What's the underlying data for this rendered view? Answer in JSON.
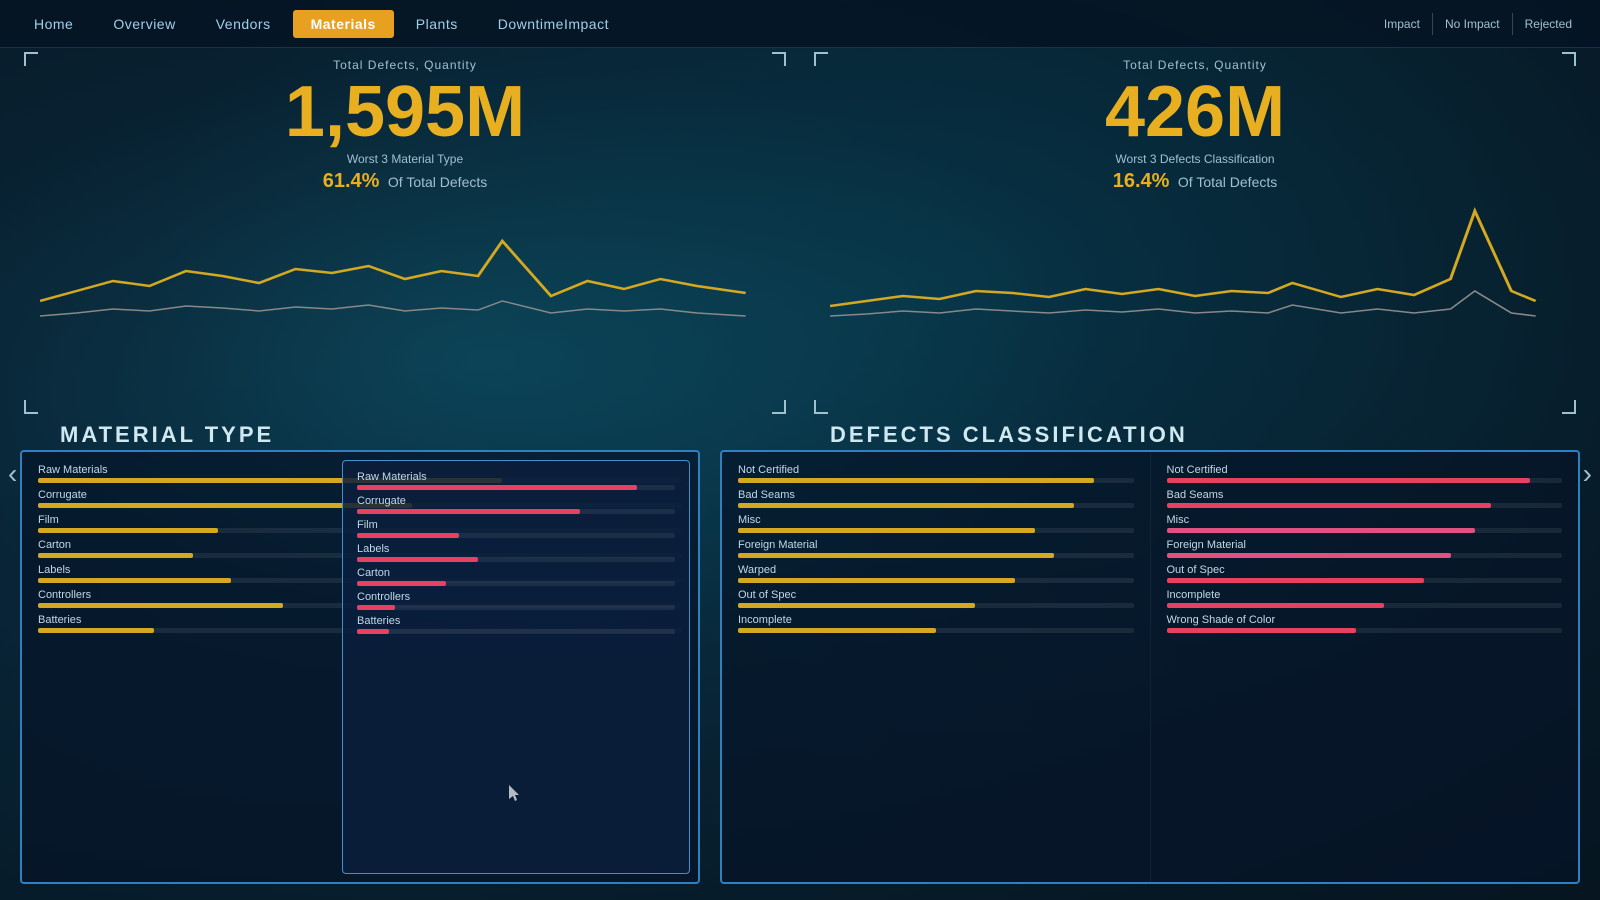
{
  "topbar": {
    "nav_items": [
      {
        "label": "Home",
        "active": false
      },
      {
        "label": "Overview",
        "active": false
      },
      {
        "label": "Vendors",
        "active": false
      },
      {
        "label": "Materials",
        "active": true
      },
      {
        "label": "Plants",
        "active": false
      },
      {
        "label": "DowntimeImpact",
        "active": false
      }
    ],
    "filters": [
      {
        "label": "Impact"
      },
      {
        "label": "No Impact"
      },
      {
        "label": "Rejected"
      }
    ]
  },
  "left_chart": {
    "title": "Total Defects, Quantity",
    "value": "1,595M",
    "subtitle": "Worst 3 Material Type",
    "pct": "61.4%",
    "pct_label": "Of Total Defects"
  },
  "right_chart": {
    "title": "Total Defects, Quantity",
    "value": "426M",
    "subtitle": "Worst 3 Defects Classification",
    "pct": "16.4%",
    "pct_label": "Of Total Defects"
  },
  "section_labels": {
    "left": "Material Type",
    "right": "Defects Classification"
  },
  "left_table_col1": {
    "rows": [
      {
        "label": "Raw Materials",
        "bar_pct": 72,
        "color": "yellow"
      },
      {
        "label": "Corrugate",
        "bar_pct": 58,
        "color": "yellow"
      },
      {
        "label": "Film",
        "bar_pct": 28,
        "color": "yellow"
      },
      {
        "label": "Carton",
        "bar_pct": 24,
        "color": "yellow"
      },
      {
        "label": "Labels",
        "bar_pct": 30,
        "color": "yellow"
      },
      {
        "label": "Controllers",
        "bar_pct": 38,
        "color": "yellow"
      },
      {
        "label": "Batteries",
        "bar_pct": 18,
        "color": "yellow"
      }
    ]
  },
  "left_table_highlight": {
    "rows": [
      {
        "label": "Raw Materials",
        "bar_pct": 88,
        "color": "red"
      },
      {
        "label": "Corrugate",
        "bar_pct": 70,
        "color": "red"
      },
      {
        "label": "Film",
        "bar_pct": 32,
        "color": "red"
      },
      {
        "label": "Labels",
        "bar_pct": 38,
        "color": "red"
      },
      {
        "label": "Carton",
        "bar_pct": 28,
        "color": "red"
      },
      {
        "label": "Controllers",
        "bar_pct": 12,
        "color": "red"
      },
      {
        "label": "Batteries",
        "bar_pct": 10,
        "color": "red"
      }
    ]
  },
  "right_table_col1": {
    "rows": [
      {
        "label": "Not Certified",
        "bar_pct": 90,
        "color": "yellow"
      },
      {
        "label": "Bad Seams",
        "bar_pct": 85,
        "color": "yellow"
      },
      {
        "label": "Misc",
        "bar_pct": 75,
        "color": "yellow"
      },
      {
        "label": "Foreign Material",
        "bar_pct": 80,
        "color": "yellow"
      },
      {
        "label": "Warped",
        "bar_pct": 70,
        "color": "yellow"
      },
      {
        "label": "Out of Spec",
        "bar_pct": 60,
        "color": "yellow"
      },
      {
        "label": "Incomplete",
        "bar_pct": 50,
        "color": "yellow"
      }
    ]
  },
  "right_table_col2": {
    "rows": [
      {
        "label": "Not Certified",
        "bar_pct": 92,
        "color": "red"
      },
      {
        "label": "Bad Seams",
        "bar_pct": 82,
        "color": "red"
      },
      {
        "label": "Misc",
        "bar_pct": 78,
        "color": "pink"
      },
      {
        "label": "Foreign Material",
        "bar_pct": 72,
        "color": "pink"
      },
      {
        "label": "Out of Spec",
        "bar_pct": 65,
        "color": "red"
      },
      {
        "label": "Incomplete",
        "bar_pct": 55,
        "color": "red"
      },
      {
        "label": "Wrong Shade of Color",
        "bar_pct": 48,
        "color": "red"
      }
    ]
  }
}
